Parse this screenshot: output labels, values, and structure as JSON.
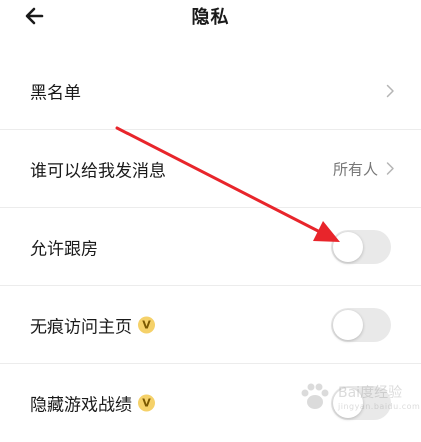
{
  "header": {
    "title": "隐私",
    "back_icon": "arrow-left-icon"
  },
  "items": [
    {
      "label": "黑名单",
      "control": "chevron"
    },
    {
      "label": "谁可以给我发消息",
      "value": "所有人",
      "control": "chevron"
    },
    {
      "label": "允许跟房",
      "control": "toggle",
      "on": false
    },
    {
      "label": "无痕访问主页",
      "badge": "V",
      "control": "toggle",
      "on": false
    },
    {
      "label": "隐藏游戏战绩",
      "badge": "V",
      "control": "toggle",
      "on": false
    }
  ],
  "watermark": {
    "text": "Bai度经验",
    "sub": "jingyan.baidu.com"
  },
  "colors": {
    "annotation_arrow": "#e8252b",
    "vip_badge": "#f5d169",
    "toggle_off_track": "#e9e9e9"
  }
}
